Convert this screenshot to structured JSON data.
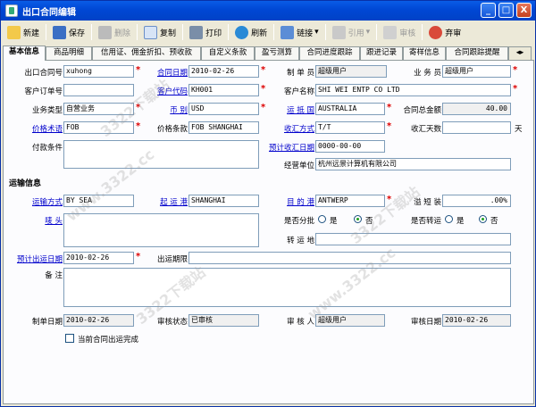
{
  "window": {
    "title": "出口合同编辑",
    "min": "_",
    "max": "□",
    "close": "X"
  },
  "toolbar": {
    "new": "新建",
    "save": "保存",
    "delete": "删除",
    "copy": "复制",
    "print": "打印",
    "refresh": "刷新",
    "link": "链接",
    "cite": "引用",
    "review": "审核",
    "unreview": "弃审"
  },
  "tabs": [
    "基本信息",
    "商品明细",
    "信用证、佣金折扣、预收款",
    "自定义条款",
    "盈亏测算",
    "合同进度跟踪",
    "跟进记录",
    "寄样信息",
    "合同跟踪提醒"
  ],
  "basic": {
    "contract_no_label": "出口合同号",
    "contract_no": "xuhong",
    "contract_date_label": "合同日期",
    "contract_date": "2010-02-26",
    "maker_label": "制 单 员",
    "maker": "超级用户",
    "salesman_label": "业 务 员",
    "salesman": "超级用户",
    "cust_order_label": "客户订单号",
    "cust_order": "",
    "cust_code_label": "客户代码",
    "cust_code": "KH001",
    "cust_name_label": "客户名称",
    "cust_name": "SHI WEI ENTP CO LTD",
    "biz_type_label": "业务类型",
    "biz_type": "自营业务",
    "currency_label": "币    别",
    "currency": "USD",
    "port_country_label": "运 抵 国",
    "port_country": "AUSTRALIA",
    "total_label": "合同总金额",
    "total": "40.00",
    "price_term_label": "价格术语",
    "price_term": "FOB",
    "price_clause_label": "价格条款",
    "price_clause": "FOB SHANGHAI",
    "fx_method_label": "收汇方式",
    "fx_method": "T/T",
    "fx_days_label": "收汇天数",
    "fx_days": "",
    "days_unit": "天",
    "payment_label": "付款条件",
    "payment": "",
    "est_fx_date_label": "预计收汇日期",
    "est_fx_date": "0000-00-00",
    "biz_unit_label": "经营单位",
    "biz_unit": "杭州远景计算机有限公司"
  },
  "shipping": {
    "section": "运输信息",
    "transport_label": "运输方式",
    "transport": "BY SEA",
    "load_port_label": "起 运 港",
    "load_port": "SHANGHAI",
    "dest_port_label": "目 的 港",
    "dest_port": "ANTWERP",
    "overshort_label": "溢 短 装",
    "overshort": ".00%",
    "mark_label": "唛    头",
    "mark": "",
    "partial_label": "是否分批",
    "yes": "是",
    "no": "否",
    "transship_label": "是否转运",
    "transit_label": "转 运 地",
    "transit": "",
    "est_ship_label": "预计出运日期",
    "est_ship": "2010-02-26",
    "ship_limit_label": "出运期限",
    "ship_limit": "",
    "remark_label": "备    注",
    "remark": ""
  },
  "footer": {
    "make_date_label": "制单日期",
    "make_date": "2010-02-26",
    "review_status_label": "审核状态",
    "review_status": "已审核",
    "reviewer_label": "审 核 人",
    "reviewer": "超级用户",
    "review_date_label": "审核日期",
    "review_date": "2010-02-26",
    "complete_label": "当前合同出运完成"
  },
  "watermark": "www.3322.cc",
  "watermark2": "3322下载站"
}
